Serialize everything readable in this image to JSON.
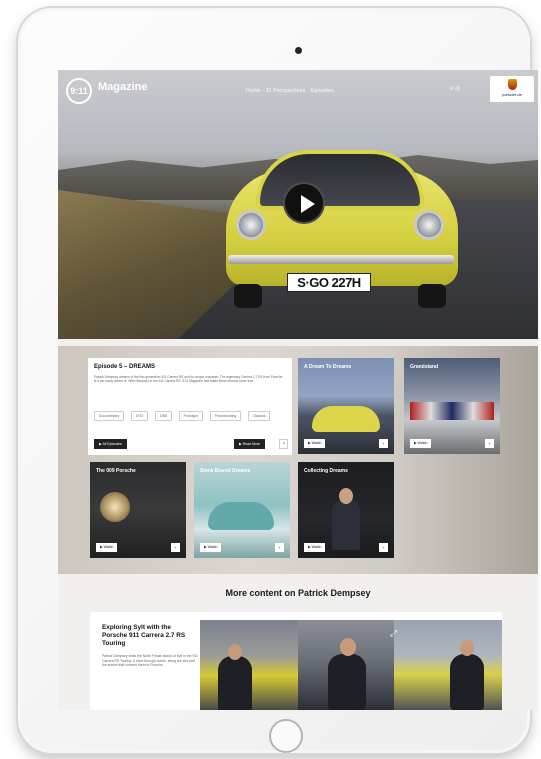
{
  "site": {
    "logo_mark": "9:11",
    "logo_text": "Magazine",
    "nav_links": "Home  ·  11 Perspectives  ·  Episodes",
    "nav_icons": "≡  ◎",
    "brand": "porsche.de"
  },
  "hero": {
    "plate": "S·GO 227H"
  },
  "episode": {
    "title": "Episode 5 – DREAMS",
    "description": "Patrick Dempsey dreams of the first generation 911 Carrera RS and its unique character. The legendary Carrera 2.7 RS from Porsche is a car many dream of. With Dempsey in the 911 Carrera RS, 9:11 Magazine has made these dreams come true.",
    "tags": [
      "Documentary",
      "1973",
      "1968",
      "Prototype",
      "Photoshooting",
      "Classics"
    ],
    "primary_btn": "▶  All Episodes",
    "secondary_btn": "▶  Read More",
    "share_btn": "↗"
  },
  "thumbnails": [
    {
      "title": "A Dream To Dreams",
      "btn": "▶  Watch"
    },
    {
      "title": "Grandstand",
      "btn": "▶  Watch"
    },
    {
      "title": "The 009 Porsche",
      "btn": "▶  Watch"
    },
    {
      "title": "Snow Bound Dreams",
      "btn": "▶  Watch"
    },
    {
      "title": "Collecting Dreams",
      "btn": "▶  Watch"
    }
  ],
  "more": {
    "heading": "More content on Patrick Dempsey",
    "feature_title": "Exploring Sylt with the Porsche 911 Carrera 2.7 RS Touring",
    "feature_desc": "Patrick Dempsey visits the North Frisian island of Sylt in the 911 Carrera RS Touring. A drive through dunes, along the sea and the stories that connect them to Porsche."
  },
  "colors": {
    "accent_dark": "#222222",
    "car_yellow": "#e2dc58"
  }
}
